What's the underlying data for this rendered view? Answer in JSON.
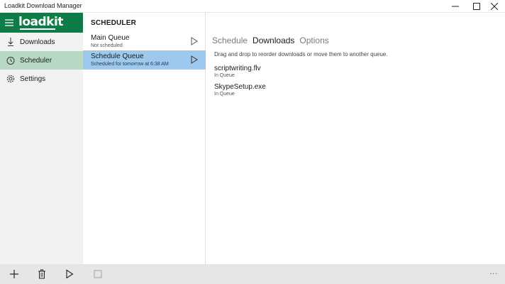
{
  "window": {
    "title": "Loadkit Download Manager"
  },
  "brand": {
    "logo_text": "loadkit",
    "color": "#0f7b46"
  },
  "sidebar": {
    "items": [
      {
        "label": "Downloads",
        "icon": "download-arrow-icon",
        "active": false
      },
      {
        "label": "Scheduler",
        "icon": "clock-icon",
        "active": true
      },
      {
        "label": "Settings",
        "icon": "gear-icon",
        "active": false
      }
    ]
  },
  "queues": {
    "header": "SCHEDULER",
    "items": [
      {
        "name": "Main Queue",
        "status": "Not scheduled",
        "selected": false
      },
      {
        "name": "Schedule Queue",
        "status": "Scheduled for tomorrow at 6:38 AM",
        "selected": true
      }
    ]
  },
  "detail": {
    "tabs": [
      {
        "label": "Schedule",
        "active": false
      },
      {
        "label": "Downloads",
        "active": true
      },
      {
        "label": "Options",
        "active": false
      }
    ],
    "hint": "Drag and drop to reorder downloads or move them to another queue.",
    "downloads": [
      {
        "name": "scriptwriting.flv",
        "status": "In Queue"
      },
      {
        "name": "SkypeSetup.exe",
        "status": "In Queue"
      }
    ]
  },
  "commandbar": {
    "buttons": [
      "add-icon",
      "trash-icon",
      "play-icon",
      "stop-icon"
    ],
    "more": "..."
  },
  "colors": {
    "selected_queue": "#9ec9ef",
    "active_nav": "#b7d9c3"
  }
}
